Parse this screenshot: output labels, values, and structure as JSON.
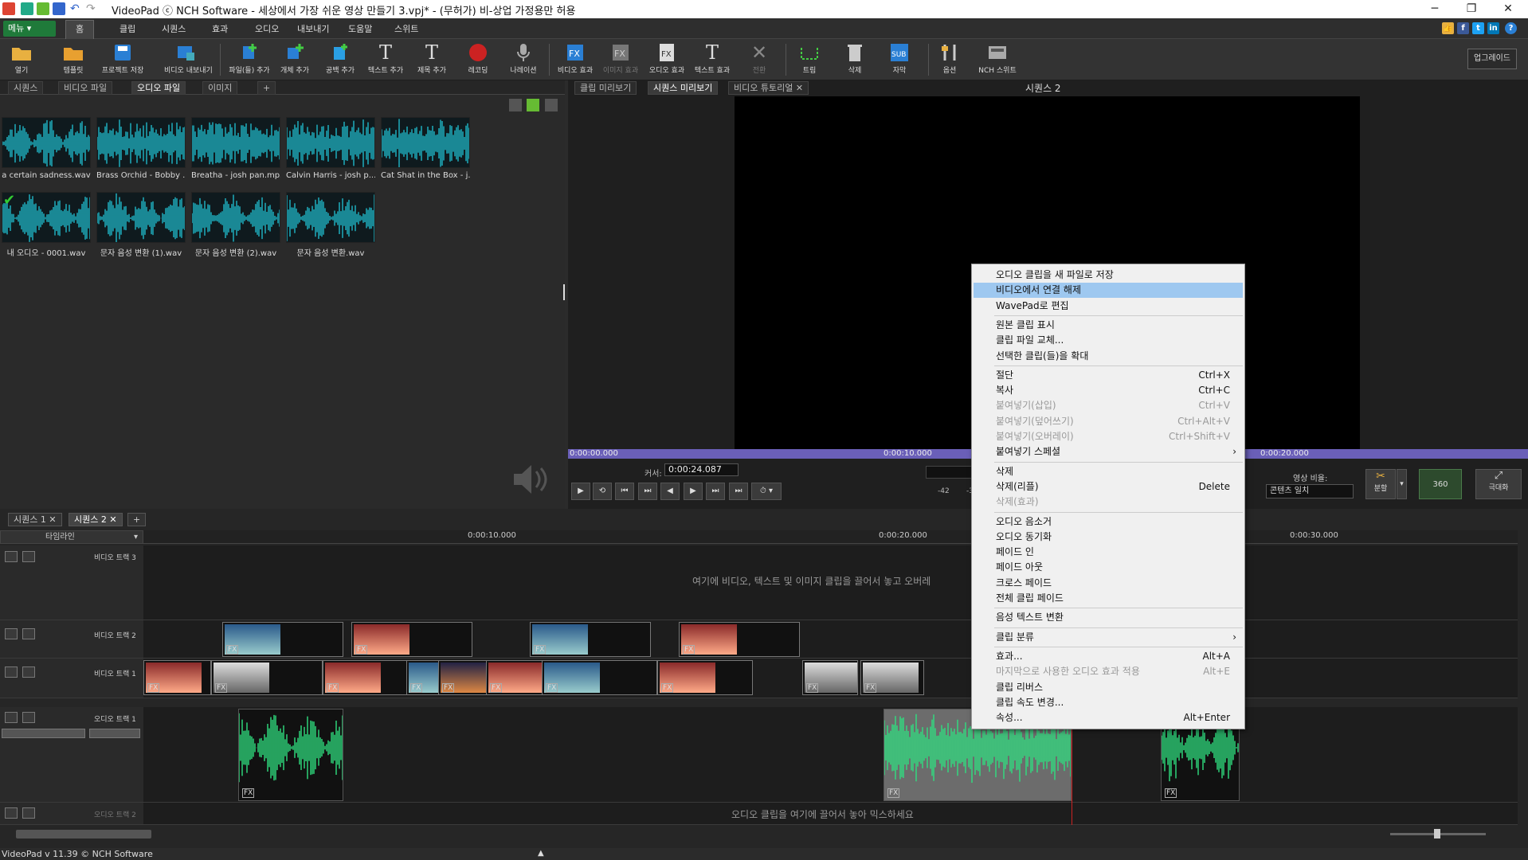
{
  "window": {
    "title": "VideoPad ⓒ NCH Software - 세상에서 가장 쉬운 영상 만들기 3.vpj* - (무허가) 비-상업 가정용만 허용",
    "controls": [
      "─",
      "❐",
      "✕"
    ]
  },
  "menubar": {
    "menu_button": "메뉴 ▾",
    "tabs": [
      "홈",
      "클립",
      "시퀀스",
      "효과",
      "오디오",
      "내보내기",
      "도움말",
      "스위트"
    ]
  },
  "toolbar": {
    "buttons": [
      "열기",
      "템플릿",
      "프로젝트 저장",
      "비디오 내보내기",
      "파일(들) 추가",
      "개체 추가",
      "공백 추가",
      "텍스트 추가",
      "제목 추가",
      "레코딩",
      "나레이션",
      "비디오 효과",
      "이미지 효과",
      "오디오 효과",
      "텍스트 효과",
      "전환",
      "트림",
      "삭제",
      "자막",
      "옵션",
      "NCH 스위트"
    ],
    "upgrade": "업그레이드"
  },
  "bin": {
    "tabs": [
      "시퀀스",
      "비디오 파일",
      "오디오 파일",
      "이미지",
      "+"
    ],
    "files": [
      "a certain sadness.wav",
      "Brass Orchid - Bobby ...",
      "Breatha - josh pan.mp3",
      "Calvin Harris - josh p...",
      "Cat Shat in the Box - j...",
      "내 오디오 - 0001.wav",
      "문자 음성 변환 (1).wav",
      "문자 음성 변환 (2).wav",
      "문자 음성 변환.wav"
    ]
  },
  "preview": {
    "tabs": [
      "클립 미리보기",
      "시퀀스 미리보기",
      "비디오 튜토리얼 ✕"
    ],
    "title": "시퀀스 2",
    "ruler": [
      "0:00:00.000",
      "0:00:10.000",
      "0:00:20.000"
    ],
    "cursor_label": "커서:",
    "cursor_value": "0:00:24.087",
    "meter": [
      "-42",
      "-3"
    ],
    "aspect_label": "영상 비율:",
    "aspect_value": "콘텐츠 일치",
    "split": "분할",
    "badge360": "360",
    "maximize": "극대화"
  },
  "timeline": {
    "tabs": [
      "시퀀스 1 ✕",
      "시퀀스 2 ✕",
      "+"
    ],
    "mode": "타임라인",
    "ruler": [
      "0:00:10.000",
      "0:00:20.000",
      "0:00:30.000"
    ],
    "tracks": [
      "비디오 트랙 3",
      "비디오 트랙 2",
      "비디오 트랙 1",
      "오디오 트랙 1",
      "오디오 트랙 2"
    ],
    "video_hint": "여기에 비디오, 텍스트 및 이미지 클립을 끌어서 놓고 오버레",
    "audio_hint": "오디오 클립을 여기에 끌어서 놓아 믹스하세요"
  },
  "context_menu": {
    "items": [
      {
        "label": "오디오 클립을 새 파일로 저장",
        "sc": ""
      },
      {
        "label": "비디오에서 연결 해제",
        "sc": ""
      },
      {
        "label": "WavePad로 편집",
        "sc": ""
      },
      {
        "label": "원본 클립 표시",
        "sc": ""
      },
      {
        "label": "클립 파일 교체...",
        "sc": ""
      },
      {
        "label": "선택한 클립(들)을 확대",
        "sc": ""
      },
      {
        "label": "절단",
        "sc": "Ctrl+X"
      },
      {
        "label": "복사",
        "sc": "Ctrl+C"
      },
      {
        "label": "붙여넣기(삽입)",
        "sc": "Ctrl+V"
      },
      {
        "label": "붙여넣기(덮어쓰기)",
        "sc": "Ctrl+Alt+V"
      },
      {
        "label": "붙여넣기(오버레이)",
        "sc": "Ctrl+Shift+V"
      },
      {
        "label": "붙여넣기 스페셜",
        "sc": ""
      },
      {
        "label": "삭제",
        "sc": ""
      },
      {
        "label": "삭제(리플)",
        "sc": "Delete"
      },
      {
        "label": "삭제(효과)",
        "sc": ""
      },
      {
        "label": "오디오 음소거",
        "sc": ""
      },
      {
        "label": "오디오 동기화",
        "sc": ""
      },
      {
        "label": "페이드 인",
        "sc": ""
      },
      {
        "label": "페이드 아웃",
        "sc": ""
      },
      {
        "label": "크로스 페이드",
        "sc": ""
      },
      {
        "label": "전체 클립 페이드",
        "sc": ""
      },
      {
        "label": "음성 텍스트 변환",
        "sc": ""
      },
      {
        "label": "클립 분류",
        "sc": ""
      },
      {
        "label": "효과...",
        "sc": "Alt+A"
      },
      {
        "label": "마지막으로 사용한 오디오 효과 적용",
        "sc": "Alt+E"
      },
      {
        "label": "클립 리버스",
        "sc": ""
      },
      {
        "label": "클립 속도 변경...",
        "sc": ""
      },
      {
        "label": "속성...",
        "sc": "Alt+Enter"
      }
    ]
  },
  "status": {
    "text": "VideoPad v 11.39 © NCH Software"
  },
  "colors": {
    "accent_green": "#1f7a3a",
    "wave_teal": "#1fb8c8",
    "wave_green": "#2fe080",
    "menu_highlight": "#9ec8f0",
    "ruler_purple": "#6a5fb8"
  }
}
